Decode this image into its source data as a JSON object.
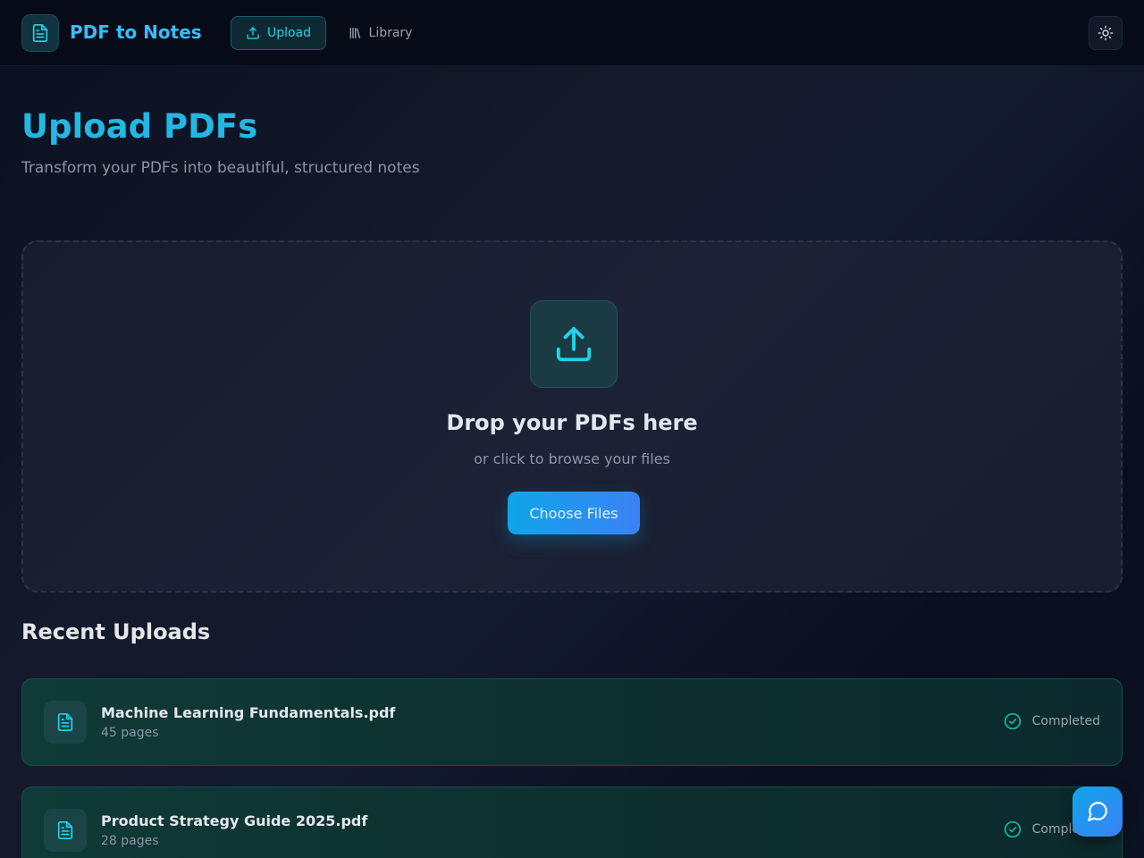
{
  "header": {
    "app_title": "PDF to Notes",
    "logo_icon": "file-text-icon",
    "nav": {
      "upload_label": "Upload",
      "library_label": "Library"
    },
    "theme_icon": "sun-icon"
  },
  "main": {
    "title": "Upload PDFs",
    "subtitle": "Transform your PDFs into beautiful, structured notes",
    "dropzone": {
      "icon": "upload-icon",
      "title": "Drop your PDFs here",
      "subtitle": "or click to browse your files",
      "button_label": "Choose Files"
    },
    "recent": {
      "title": "Recent Uploads",
      "items": [
        {
          "name": "Machine Learning Fundamentals.pdf",
          "pages": "45 pages",
          "status": "Completed"
        },
        {
          "name": "Product Strategy Guide 2025.pdf",
          "pages": "28 pages",
          "status": "Completed"
        }
      ]
    }
  },
  "colors": {
    "accent": "#22d3ee",
    "brand": "#38bdf8",
    "button_gradient_start": "#0ea5e9",
    "button_gradient_end": "#3b82f6"
  },
  "chat_icon": "message-circle-icon"
}
